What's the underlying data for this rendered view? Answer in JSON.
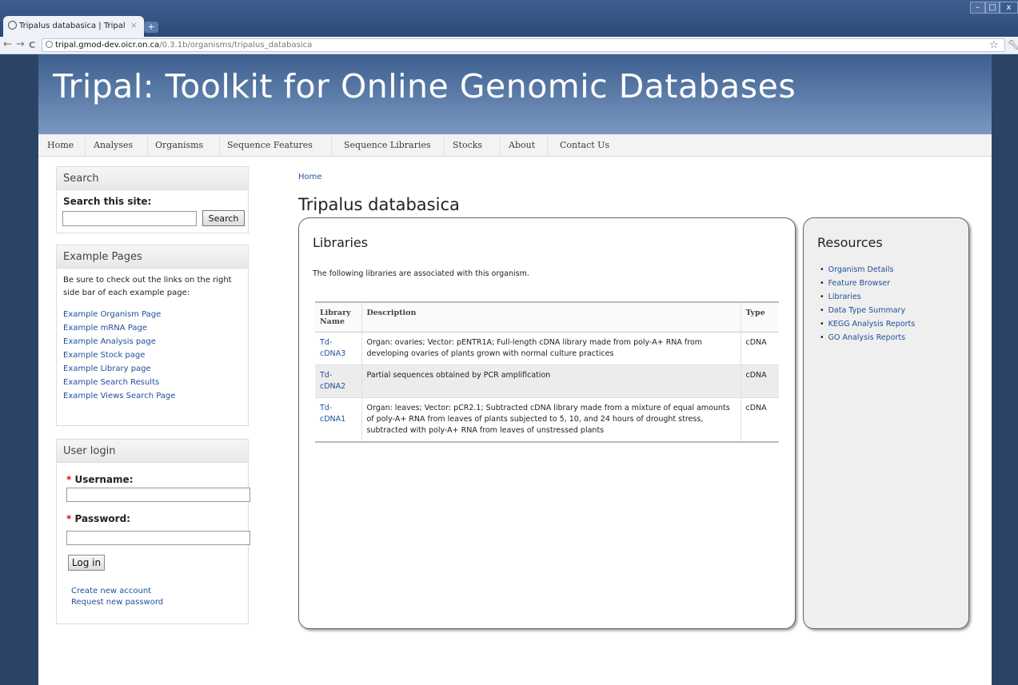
{
  "browser": {
    "tab_title": "Tripalus databasica | Tripal",
    "tab_close": "×",
    "new_tab": "+",
    "url_host": "tripal.gmod-dev.oicr.on.ca",
    "url_path": "/0.3.1b/organisms/tripalus_databasica",
    "back": "←",
    "forward": "→",
    "reload": "C",
    "star": "☆",
    "min": "–",
    "max": "□",
    "close": "x"
  },
  "site": {
    "title": "Tripal: Toolkit for Online Genomic Databases"
  },
  "nav": [
    "Home",
    "Analyses",
    "Organisms",
    "Sequence Features",
    "Sequence Libraries",
    "Stocks",
    "About",
    "Contact Us"
  ],
  "search_block": {
    "title": "Search",
    "label": "Search this site:",
    "button": "Search"
  },
  "example_block": {
    "title": "Example Pages",
    "intro": "Be sure to check out the links on the right side bar of each example page:",
    "links": [
      "Example Organism Page",
      "Example mRNA Page",
      "Example Analysis page",
      "Example Stock page",
      "Example Library page",
      "Example Search Results",
      "Example Views Search Page"
    ]
  },
  "login_block": {
    "title": "User login",
    "required": "*",
    "username_label": "Username:",
    "password_label": "Password:",
    "button": "Log in",
    "create_account": "Create new account",
    "request_password": "Request new password"
  },
  "main": {
    "breadcrumb": "Home",
    "page_title": "Tripalus databasica",
    "section_title": "Libraries",
    "intro": "The following libraries are associated with this organism.",
    "columns": [
      "Library Name",
      "Description",
      "Type"
    ],
    "rows": [
      {
        "name": "Td-cDNA3",
        "description": "Organ: ovaries; Vector: pENTR1A; Full-length cDNA library made from poly-A+ RNA from developing ovaries of plants grown with normal culture practices",
        "type": "cDNA"
      },
      {
        "name": "Td-cDNA2",
        "description": "Partial sequences obtained by PCR amplification",
        "type": "cDNA"
      },
      {
        "name": "Td-cDNA1",
        "description": "Organ: leaves; Vector: pCR2.1; Subtracted cDNA library made from a mixture of equal amounts of poly-A+ RNA from leaves of plants subjected to 5, 10, and 24 hours of drought stress, subtracted with poly-A+ RNA from leaves of unstressed plants",
        "type": "cDNA"
      }
    ]
  },
  "resources": {
    "title": "Resources",
    "links": [
      "Organism Details",
      "Feature Browser",
      "Libraries",
      "Data Type Summary",
      "KEGG Analysis Reports",
      "GO Analysis Reports"
    ]
  }
}
